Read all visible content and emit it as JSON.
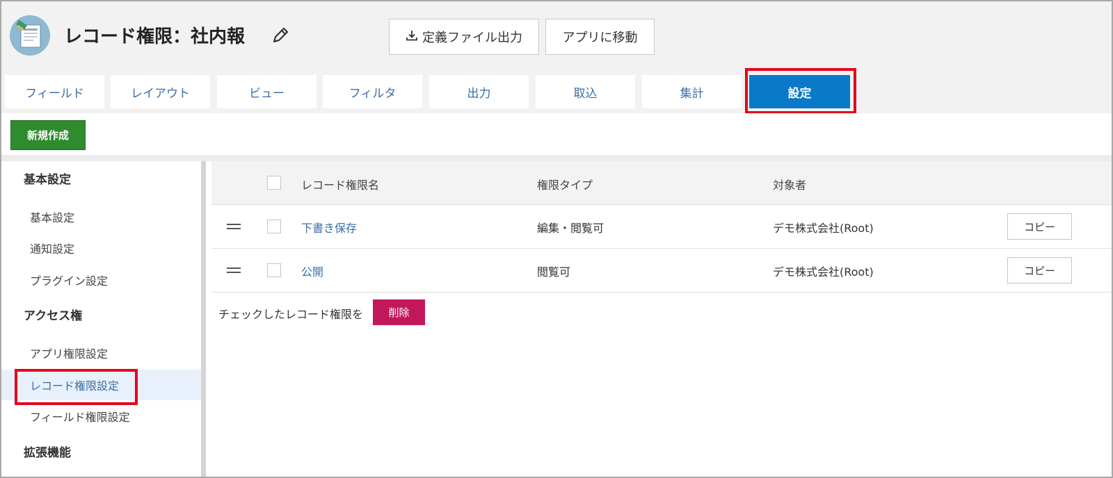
{
  "header": {
    "app_title": "レコード権限：社内報",
    "export_label": "定義ファイル出力",
    "goto_app_label": "アプリに移動"
  },
  "tabs": [
    {
      "label": "フィールド",
      "active": false
    },
    {
      "label": "レイアウト",
      "active": false
    },
    {
      "label": "ビュー",
      "active": false
    },
    {
      "label": "フィルタ",
      "active": false
    },
    {
      "label": "出力",
      "active": false
    },
    {
      "label": "取込",
      "active": false
    },
    {
      "label": "集計",
      "active": false
    },
    {
      "label": "設定",
      "active": true
    }
  ],
  "toolbar": {
    "new_label": "新規作成"
  },
  "sidebar": {
    "sections": [
      {
        "title": "基本設定",
        "items": [
          "基本設定",
          "通知設定",
          "プラグイン設定"
        ]
      },
      {
        "title": "アクセス権",
        "items": [
          "アプリ権限設定",
          "レコード権限設定",
          "フィールド権限設定"
        ]
      },
      {
        "title": "拡張機能",
        "items": []
      }
    ],
    "active_item": "レコード権限設定"
  },
  "table": {
    "columns": [
      "レコード権限名",
      "権限タイプ",
      "対象者"
    ],
    "rows": [
      {
        "name": "下書き保存",
        "type": "編集・閲覧可",
        "target": "デモ株式会社(Root)",
        "copy_label": "コピー"
      },
      {
        "name": "公開",
        "type": "閲覧可",
        "target": "デモ株式会社(Root)",
        "copy_label": "コピー"
      }
    ]
  },
  "footer": {
    "text": "チェックしたレコード権限を",
    "delete_label": "削除"
  },
  "colors": {
    "accent": "#0a79c8",
    "link": "#3a6ea5",
    "new_button": "#2e8b2e",
    "delete_button": "#c2185b",
    "highlight": "#e5001c"
  }
}
